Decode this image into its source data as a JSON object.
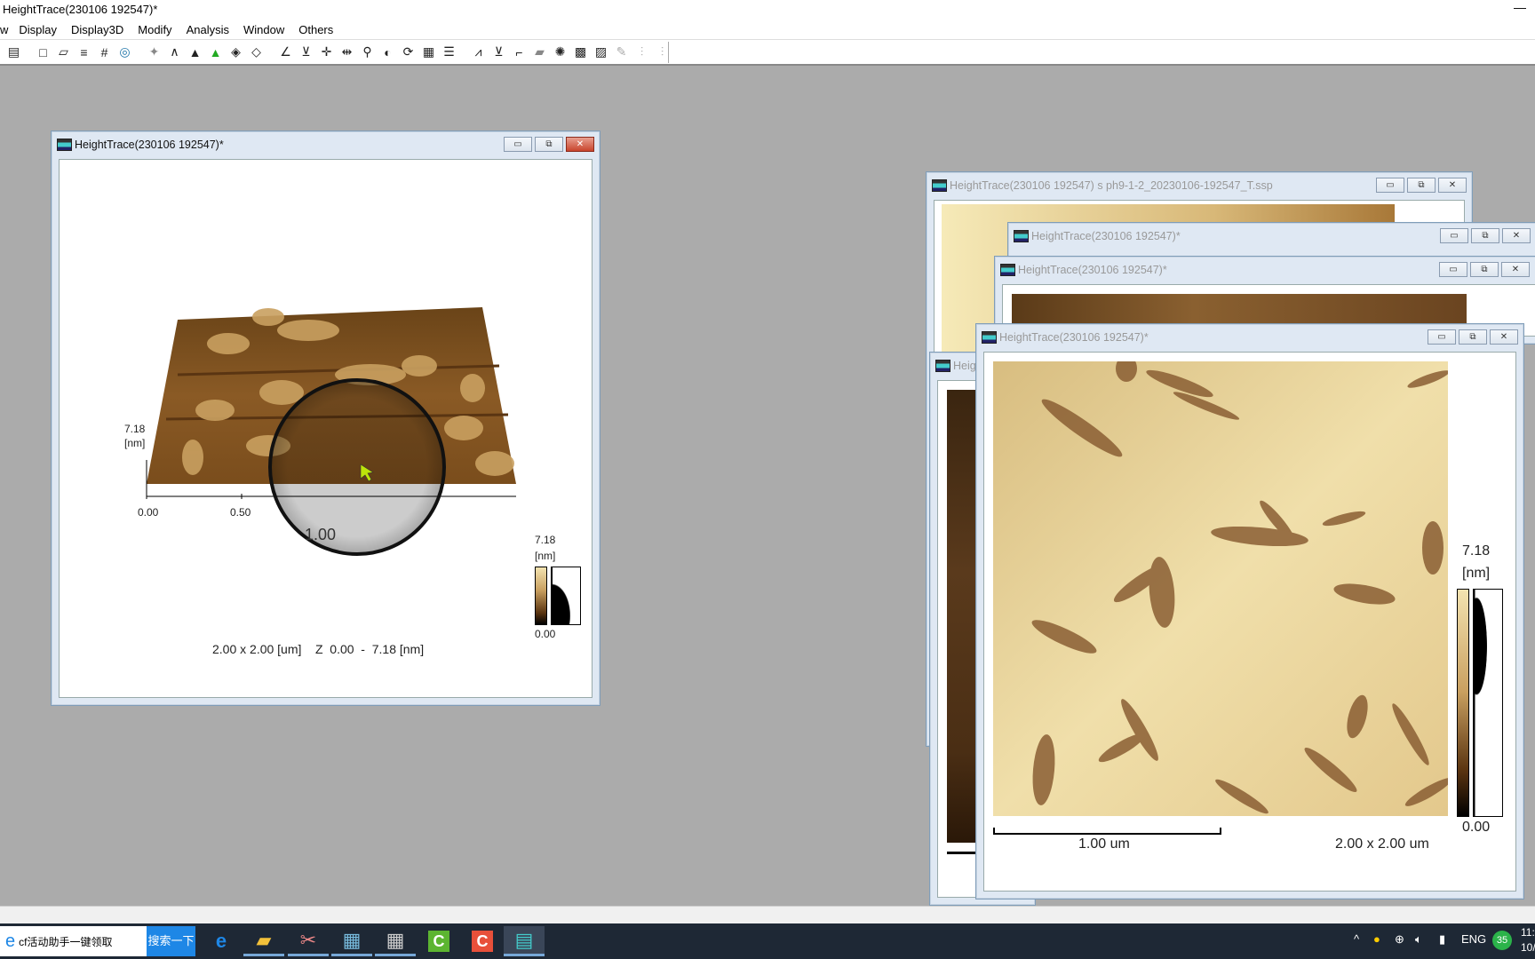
{
  "app": {
    "title": "HeightTrace(230106 192547)*",
    "window_controls": "—"
  },
  "menu": [
    "w",
    "Display",
    "Display3D",
    "Modify",
    "Analysis",
    "Window",
    "Others"
  ],
  "toolbar_icons": [
    "print-preview",
    "rectangle",
    "parallelogram",
    "list-lines",
    "grid-hash",
    "contour",
    "sparkle",
    "peak-outline",
    "peak-dark",
    "peak-color",
    "mesh",
    "mesh-outline",
    "angle-measure",
    "level",
    "cross-arrows",
    "split-arrows",
    "zoom",
    "contrast",
    "refresh",
    "grid-table",
    "lines",
    "profile",
    "slope",
    "step",
    "flatten",
    "target",
    "checker",
    "checker-alt",
    "pin",
    "histogram-a",
    "histogram-b"
  ],
  "windows": {
    "three_d": {
      "title": "HeightTrace(230106 192547)*",
      "z_top": "7.18",
      "z_unit": "[nm]",
      "x_ticks": [
        "0.00",
        "0.50",
        "1.00"
      ],
      "colorbar_max": "7.18",
      "colorbar_unit": "[nm]",
      "colorbar_min": "0.00",
      "caption": "2.00 x 2.00 [um]    Z  0.00  -  7.18 [nm]"
    },
    "back_a": {
      "title": "HeightTrace(230106 192547) s ph9-1-2_20230106-192547_T.ssp"
    },
    "back_b": {
      "title": "HeightTrace(230106 192547)*"
    },
    "back_c": {
      "title": "HeightTrace(230106 192547)*"
    },
    "back_e": {
      "title": "Heig"
    },
    "front": {
      "title": "HeightTrace(230106 192547)*",
      "colorbar_max": "7.18",
      "colorbar_unit": "[nm]",
      "colorbar_min": "0.00",
      "scalebar": "1.00 um",
      "size": "2.00 x 2.00 um"
    }
  },
  "colors": {
    "afm_light": "#f3e3b0",
    "afm_mid": "#c9a060",
    "afm_dark": "#5a3410",
    "active_close": "#c9442c"
  },
  "taskbar": {
    "search_text": "cf活动助手一键领取",
    "search_button": "搜索一下",
    "apps": [
      "edge",
      "file-explorer",
      "snip",
      "sketch-tool",
      "calculator",
      "camtasia-green",
      "camtasia-red",
      "spm-viewer"
    ],
    "tray_lang": "ENG",
    "tray_badge": "35",
    "clock_time": "11:",
    "clock_date": "10/"
  }
}
